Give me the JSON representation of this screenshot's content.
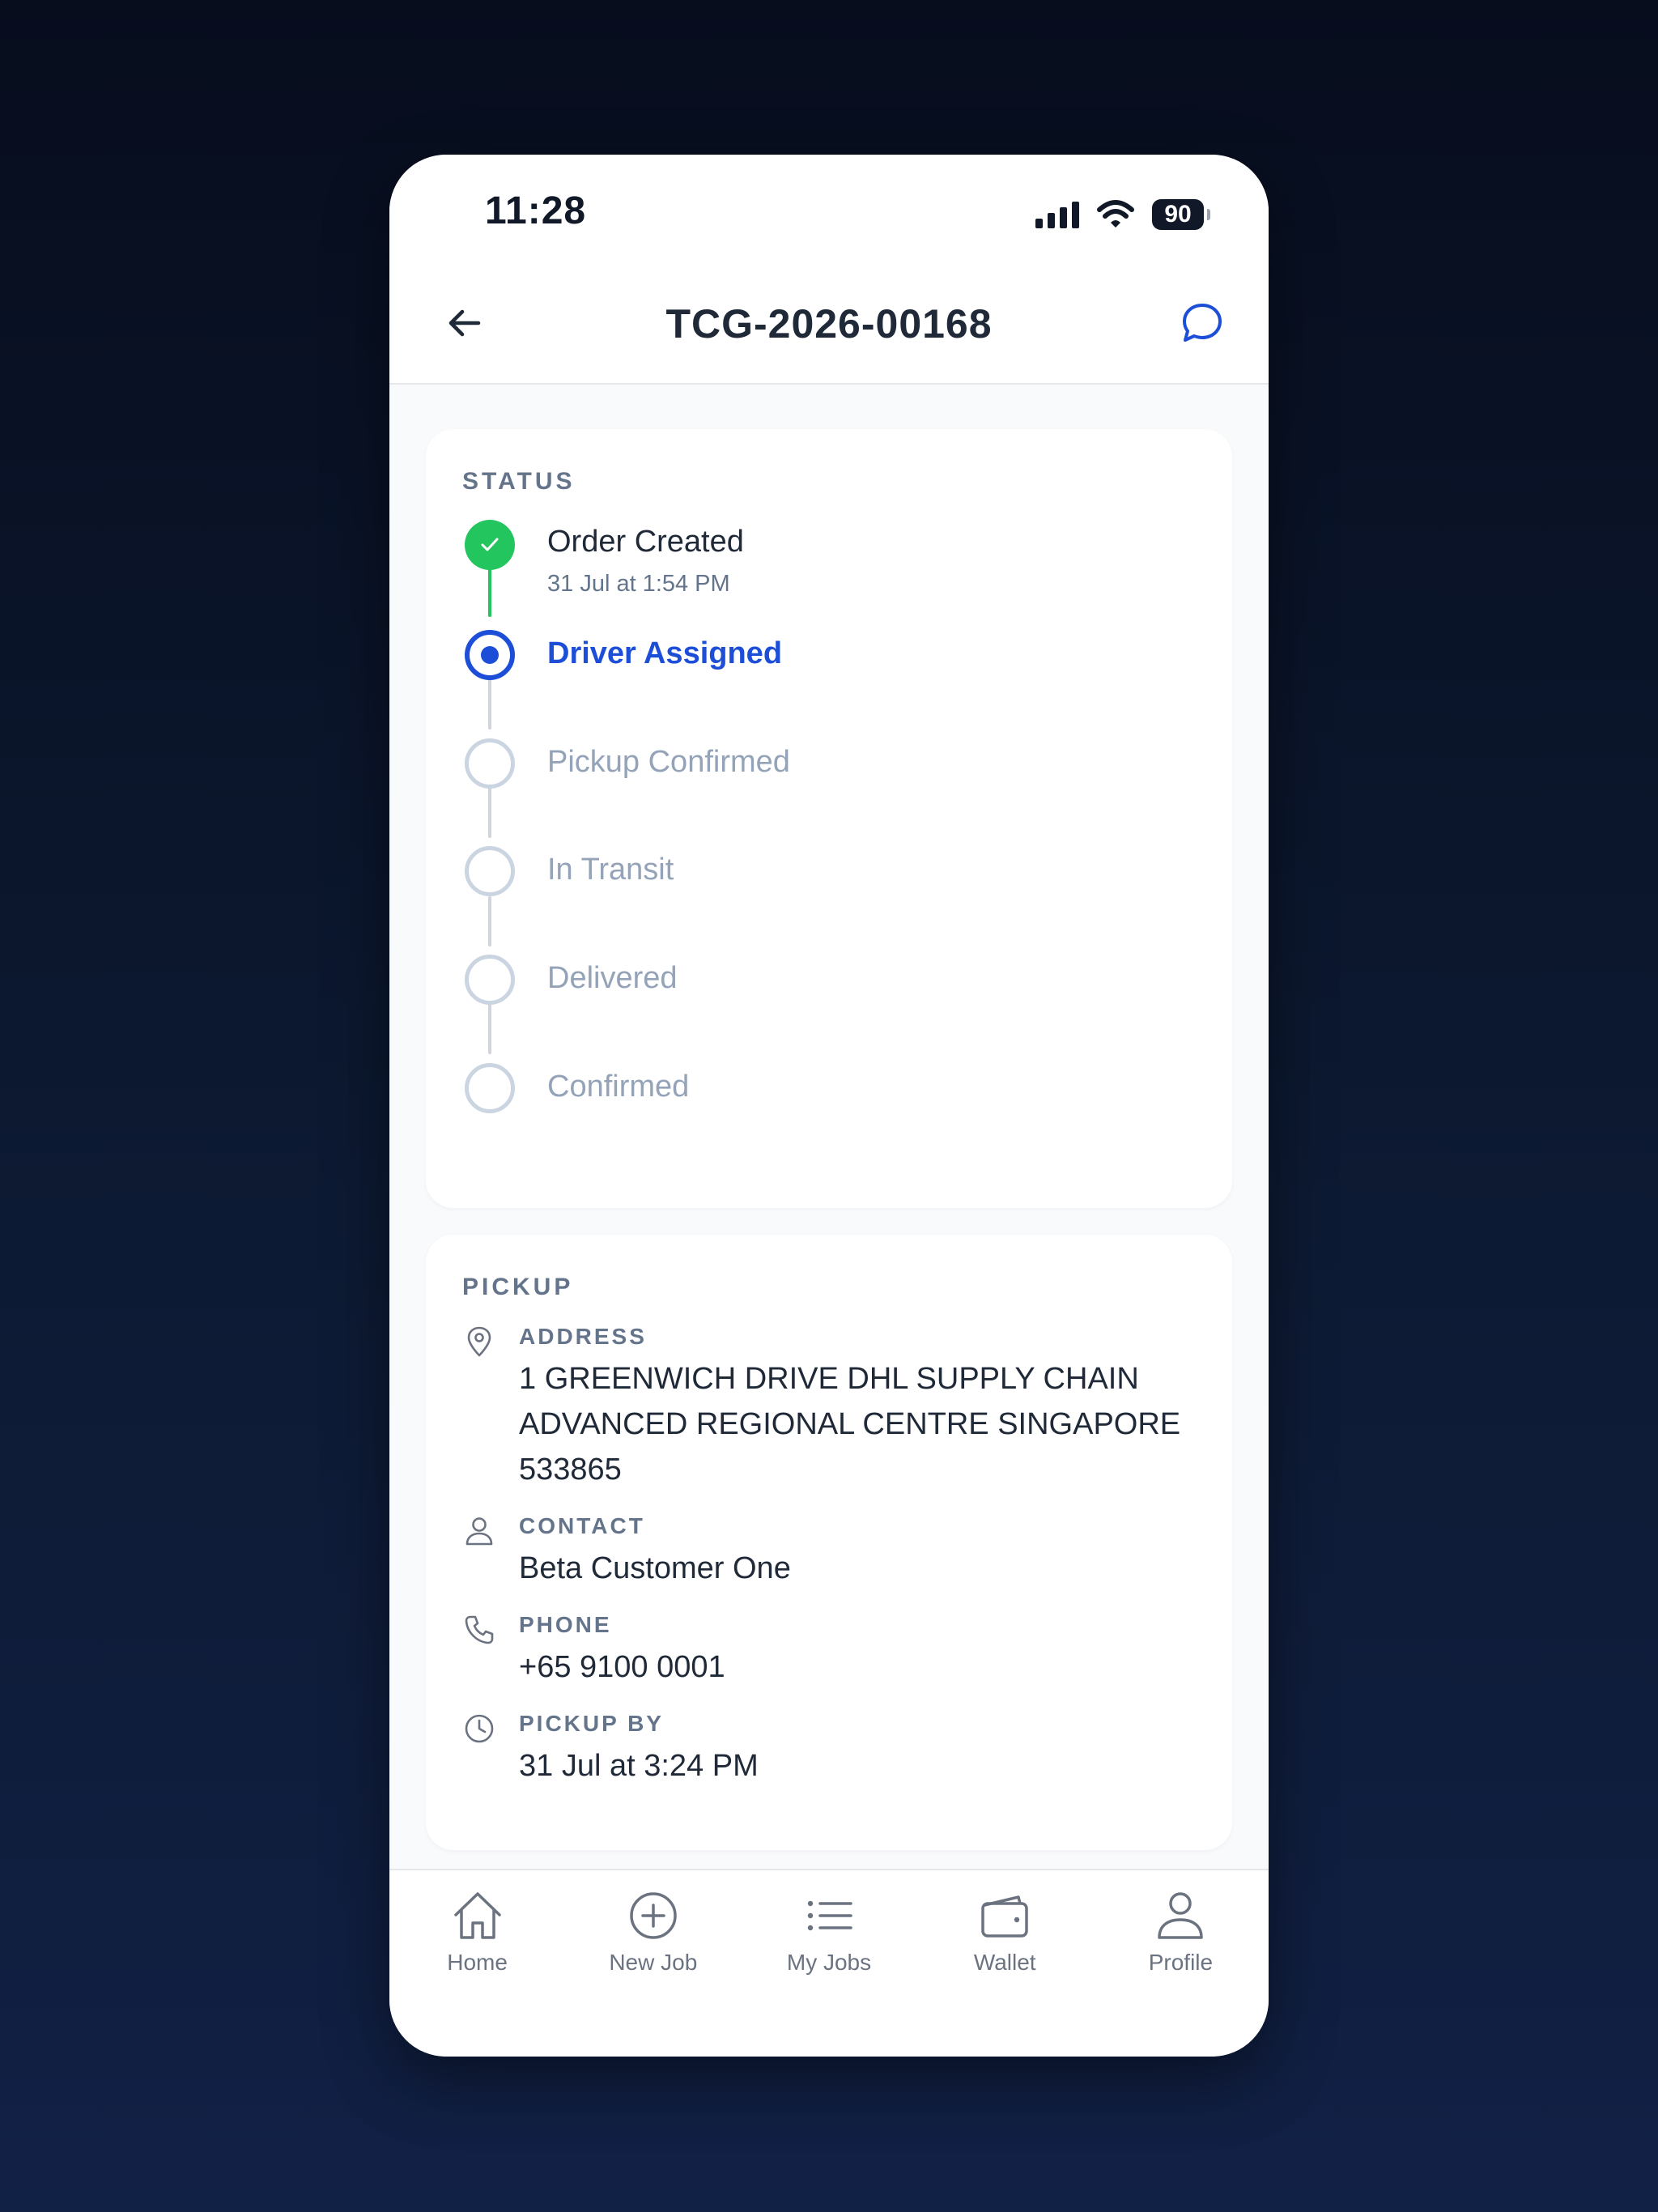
{
  "status_bar": {
    "time": "11:28",
    "battery": "90"
  },
  "header": {
    "title": "TCG-2026-00168",
    "back_icon": "arrow-left-icon",
    "chat_icon": "chat-bubble-icon"
  },
  "status_section": {
    "title": "STATUS",
    "steps": [
      {
        "label": "Order Created",
        "time": "31 Jul at 1:54 PM",
        "state": "done"
      },
      {
        "label": "Driver Assigned",
        "state": "active"
      },
      {
        "label": "Pickup Confirmed",
        "state": "pending"
      },
      {
        "label": "In Transit",
        "state": "pending"
      },
      {
        "label": "Delivered",
        "state": "pending"
      },
      {
        "label": "Confirmed",
        "state": "pending"
      }
    ]
  },
  "pickup_section": {
    "title": "PICKUP",
    "address": {
      "label": "ADDRESS",
      "value": "1 GREENWICH DRIVE DHL SUPPLY CHAIN ADVANCED REGIONAL CENTRE SINGAPORE 533865",
      "icon": "map-pin-icon"
    },
    "contact": {
      "label": "CONTACT",
      "value": "Beta Customer One",
      "icon": "user-icon"
    },
    "phone": {
      "label": "PHONE",
      "value": "+65 9100 0001",
      "icon": "phone-icon"
    },
    "pickup_by": {
      "label": "PICKUP BY",
      "value": "31 Jul at 3:24 PM",
      "icon": "clock-icon"
    }
  },
  "bottom_nav": {
    "items": [
      {
        "label": "Home",
        "icon": "home-icon"
      },
      {
        "label": "New Job",
        "icon": "plus-circle-icon"
      },
      {
        "label": "My Jobs",
        "icon": "list-icon"
      },
      {
        "label": "Wallet",
        "icon": "wallet-icon"
      },
      {
        "label": "Profile",
        "icon": "profile-icon"
      }
    ]
  },
  "colors": {
    "accent": "#1d4ed8",
    "done": "#22c55e",
    "pending": "#94a3b8",
    "muted_label": "#64748b"
  }
}
